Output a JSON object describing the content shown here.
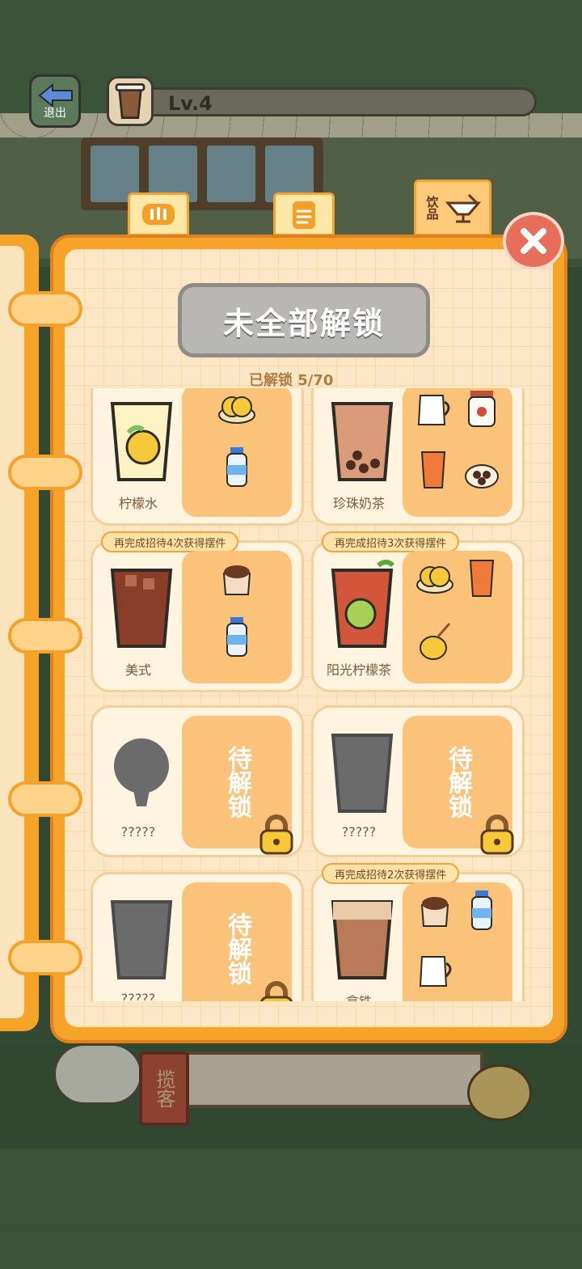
{
  "header": {
    "exit_label": "退出",
    "level": "Lv.4"
  },
  "tabs": [
    {
      "name": "bread",
      "icon": "bread-icon"
    },
    {
      "name": "list",
      "icon": "clipboard-icon"
    },
    {
      "name": "drinks",
      "icon": "drink-icon",
      "label": "饮品",
      "active": true
    }
  ],
  "book": {
    "banner": "未全部解锁",
    "progress": "已解锁 5/70",
    "locked_label": "待解锁",
    "cards": [
      {
        "name": "柠檬水",
        "cup": "lemonade",
        "task": "",
        "ingredients": [
          "lemon-slices-icon",
          "water-bottle-icon"
        ]
      },
      {
        "name": "珍珠奶茶",
        "cup": "bubble-tea",
        "task": "",
        "ingredients": [
          "milk-jug-icon",
          "tea-jar-icon",
          "juice-glass-icon",
          "pearls-icon"
        ]
      },
      {
        "name": "美式",
        "cup": "americano",
        "task": "再完成招待4次获得摆件",
        "ingredients": [
          "coffee-beans-icon",
          "water-bottle-icon"
        ]
      },
      {
        "name": "阳光柠檬茶",
        "cup": "lemon-tea",
        "task": "再完成招待3次获得摆件",
        "ingredients": [
          "lemon-slices-icon",
          "juice-glass-icon",
          "honey-jar-icon"
        ]
      },
      {
        "name": "?????",
        "cup": "locked-dessert",
        "task": "",
        "locked": true
      },
      {
        "name": "?????",
        "cup": "locked-cup",
        "task": "",
        "locked": true
      },
      {
        "name": "?????",
        "cup": "locked-cup",
        "task": "",
        "locked": true
      },
      {
        "name": "拿铁",
        "cup": "latte",
        "task": "再完成招待2次获得摆件",
        "ingredients": [
          "coffee-beans-icon",
          "water-bottle-icon",
          "milk-jug-icon"
        ]
      }
    ]
  },
  "scene": {
    "hanging_sign": "揽客"
  },
  "colors": {
    "book_orange": "#f6a32a",
    "page_cream": "#fbe7c6",
    "panel_orange": "#fbc27a",
    "banner_gray": "#b9b7b4",
    "close_red": "#e66e5a"
  }
}
